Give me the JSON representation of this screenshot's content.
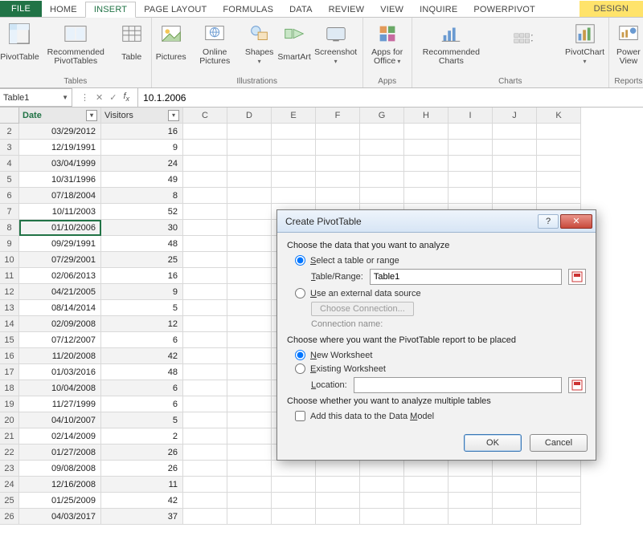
{
  "ribbon_tabs": {
    "file": "FILE",
    "home": "HOME",
    "insert": "INSERT",
    "page_layout": "PAGE LAYOUT",
    "formulas": "FORMULAS",
    "data": "DATA",
    "review": "REVIEW",
    "view": "VIEW",
    "inquire": "INQUIRE",
    "powerpivot": "POWERPIVOT",
    "design": "DESIGN"
  },
  "ribbon_groups": {
    "tables": {
      "label": "Tables",
      "pivot": "PivotTable",
      "recommended": "Recommended PivotTables",
      "table": "Table"
    },
    "illustrations": {
      "label": "Illustrations",
      "pictures": "Pictures",
      "online_pictures": "Online Pictures",
      "shapes": "Shapes",
      "smartart": "SmartArt",
      "screenshot": "Screenshot"
    },
    "apps": {
      "label": "Apps",
      "apps_for_office": "Apps for Office"
    },
    "charts": {
      "label": "Charts",
      "recommended_charts": "Recommended Charts",
      "pivotchart": "PivotChart"
    },
    "reports": {
      "label": "Reports",
      "power_view": "Power View"
    }
  },
  "namebox_value": "Table1",
  "formula_bar_value": "10.1.2006",
  "column_letters": [
    "C",
    "D",
    "E",
    "F",
    "G",
    "H",
    "I",
    "J",
    "K"
  ],
  "table": {
    "headers": {
      "date": "Date",
      "visitors": "Visitors"
    },
    "rows": [
      {
        "n": "2",
        "date": "03/29/2012",
        "v": "16"
      },
      {
        "n": "3",
        "date": "12/19/1991",
        "v": "9"
      },
      {
        "n": "4",
        "date": "03/04/1999",
        "v": "24"
      },
      {
        "n": "5",
        "date": "10/31/1996",
        "v": "49"
      },
      {
        "n": "6",
        "date": "07/18/2004",
        "v": "8"
      },
      {
        "n": "7",
        "date": "10/11/2003",
        "v": "52"
      },
      {
        "n": "8",
        "date": "01/10/2006",
        "v": "30"
      },
      {
        "n": "9",
        "date": "09/29/1991",
        "v": "48"
      },
      {
        "n": "10",
        "date": "07/29/2001",
        "v": "25"
      },
      {
        "n": "11",
        "date": "02/06/2013",
        "v": "16"
      },
      {
        "n": "12",
        "date": "04/21/2005",
        "v": "9"
      },
      {
        "n": "13",
        "date": "08/14/2014",
        "v": "5"
      },
      {
        "n": "14",
        "date": "02/09/2008",
        "v": "12"
      },
      {
        "n": "15",
        "date": "07/12/2007",
        "v": "6"
      },
      {
        "n": "16",
        "date": "11/20/2008",
        "v": "42"
      },
      {
        "n": "17",
        "date": "01/03/2016",
        "v": "48"
      },
      {
        "n": "18",
        "date": "10/04/2008",
        "v": "6"
      },
      {
        "n": "19",
        "date": "11/27/1999",
        "v": "6"
      },
      {
        "n": "20",
        "date": "04/10/2007",
        "v": "5"
      },
      {
        "n": "21",
        "date": "02/14/2009",
        "v": "2"
      },
      {
        "n": "22",
        "date": "01/27/2008",
        "v": "26"
      },
      {
        "n": "23",
        "date": "09/08/2008",
        "v": "26"
      },
      {
        "n": "24",
        "date": "12/16/2008",
        "v": "11"
      },
      {
        "n": "25",
        "date": "01/25/2009",
        "v": "42"
      },
      {
        "n": "26",
        "date": "04/03/2017",
        "v": "37"
      }
    ],
    "active_row_index": 6
  },
  "dialog": {
    "title": "Create PivotTable",
    "sect1": "Choose the data that you want to analyze",
    "opt_select_range": "Select a table or range",
    "table_range_label": "Table/Range:",
    "table_range_value": "Table1",
    "opt_external": "Use an external data source",
    "choose_connection": "Choose Connection...",
    "connection_name_label": "Connection name:",
    "sect2": "Choose where you want the PivotTable report to be placed",
    "opt_new_ws": "New Worksheet",
    "opt_existing_ws": "Existing Worksheet",
    "location_label": "Location:",
    "sect3": "Choose whether you want to analyze multiple tables",
    "add_to_model": "Add this data to the Data Model",
    "ok": "OK",
    "cancel": "Cancel"
  }
}
